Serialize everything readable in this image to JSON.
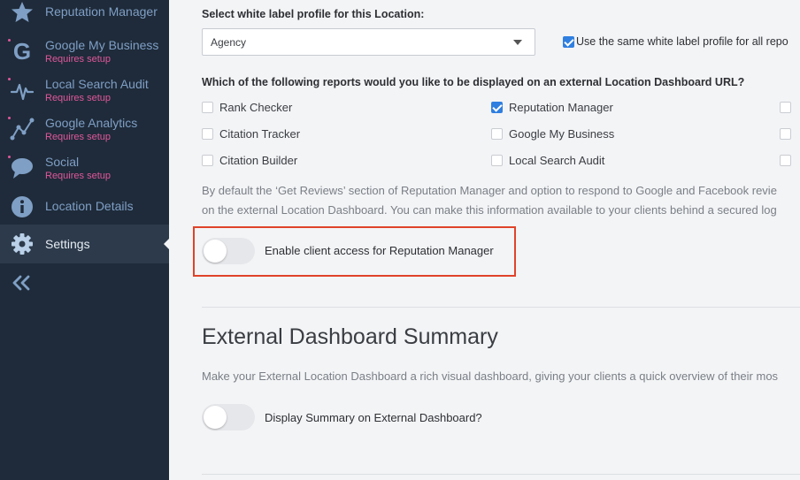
{
  "sidebar": {
    "items": [
      {
        "label": "Reputation Manager",
        "sub": "",
        "icon": "star-icon"
      },
      {
        "label": "Google My Business",
        "sub": "Requires setup",
        "icon": "google-icon"
      },
      {
        "label": "Local Search Audit",
        "sub": "Requires setup",
        "icon": "pulse-icon"
      },
      {
        "label": "Google Analytics",
        "sub": "Requires setup",
        "icon": "analytics-icon"
      },
      {
        "label": "Social",
        "sub": "Requires setup",
        "icon": "chat-bubble-icon"
      },
      {
        "label": "Location Details",
        "sub": "",
        "icon": "info-icon"
      },
      {
        "label": "Settings",
        "sub": "",
        "icon": "gear-icon"
      }
    ],
    "collapse_icon": "double-chevron-left-icon"
  },
  "main": {
    "white_label_heading": "Select white label profile for this Location:",
    "white_label_select": {
      "value": "Agency"
    },
    "same_profile_label": "Use the same white label profile for all repo",
    "reports_heading": "Which of the following reports would you like to be displayed on an external Location Dashboard URL?",
    "reports": [
      {
        "label": "Rank Checker",
        "checked": false
      },
      {
        "label": "Reputation Manager",
        "checked": true
      },
      {
        "label": "Citation Tracker",
        "checked": false
      },
      {
        "label": "Google My Business",
        "checked": false
      },
      {
        "label": "Citation Builder",
        "checked": false
      },
      {
        "label": "Local Search Audit",
        "checked": false
      }
    ],
    "default_para_line1": "By default the ‘Get Reviews’ section of Reputation Manager and option to respond to Google and Facebook revie",
    "default_para_line2": "on the external Location Dashboard. You can make this information available to your clients behind a secured log",
    "client_access_label": "Enable client access for Reputation Manager",
    "summary_title": "External Dashboard Summary",
    "summary_para": "Make your External Location Dashboard a rich visual dashboard, giving your clients a quick overview of their mos",
    "summary_toggle_label": "Display Summary on External Dashboard?"
  },
  "colors": {
    "sidebar_bg": "#1f2b3a",
    "accent": "#2f7fe0",
    "highlight": "#e0432a",
    "setup_pink": "#e0579a"
  }
}
